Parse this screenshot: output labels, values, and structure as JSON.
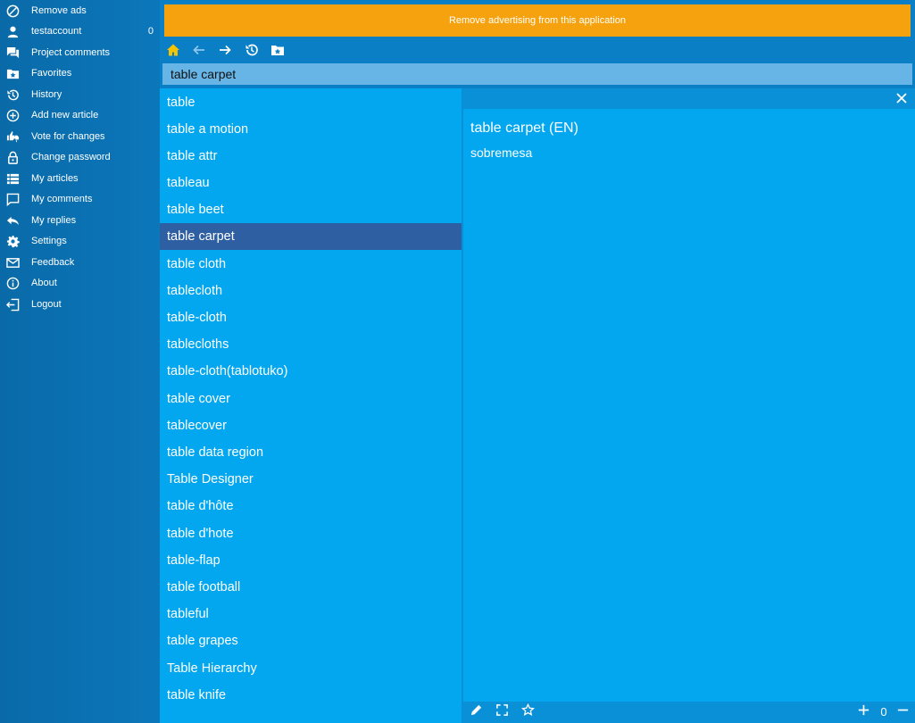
{
  "sidebar": {
    "items": [
      {
        "label": "Remove ads",
        "icon": "block-icon"
      },
      {
        "label": "testaccount",
        "icon": "user-icon",
        "count": "0"
      },
      {
        "label": "Project comments",
        "icon": "comments-icon"
      },
      {
        "label": "Favorites",
        "icon": "folder-star-icon"
      },
      {
        "label": "History",
        "icon": "history-icon"
      },
      {
        "label": "Add new article",
        "icon": "add-circle-icon"
      },
      {
        "label": "Vote for changes",
        "icon": "thumbs-icon"
      },
      {
        "label": "Change password",
        "icon": "lock-icon"
      },
      {
        "label": "My articles",
        "icon": "list-icon"
      },
      {
        "label": "My comments",
        "icon": "comment-icon"
      },
      {
        "label": "My replies",
        "icon": "reply-icon"
      },
      {
        "label": "Settings",
        "icon": "gear-icon"
      },
      {
        "label": "Feedback",
        "icon": "mail-icon"
      },
      {
        "label": "About",
        "icon": "info-icon"
      },
      {
        "label": "Logout",
        "icon": "logout-icon"
      }
    ]
  },
  "ad_banner": {
    "text": "Remove advertising from this application"
  },
  "toolbar": {
    "home_color": "#f5c400",
    "icons": [
      "home-icon",
      "back-icon",
      "forward-icon",
      "history-icon",
      "folder-star-icon"
    ]
  },
  "search": {
    "value": "table carpet"
  },
  "word_list": {
    "selected_index": 5,
    "items": [
      "table",
      "table a motion",
      "table attr",
      "tableau",
      "table beet",
      "table carpet",
      "table cloth",
      "tablecloth",
      "table-cloth",
      "tablecloths",
      "table-cloth(tablotuko)",
      "table cover",
      "tablecover",
      "table data region",
      "Table Designer",
      "table d'hôte",
      "table d'hote",
      "table-flap",
      "table football",
      "tableful",
      "table grapes",
      "Table Hierarchy",
      "table knife"
    ]
  },
  "entry": {
    "title": "table carpet (EN)",
    "translation": "sobremesa"
  },
  "footer": {
    "zoom": "0",
    "icons": [
      "edit-icon",
      "fullscreen-icon",
      "star-icon",
      "zoom-in-icon",
      "zoom-out-icon"
    ]
  },
  "colors": {
    "sidebar": "#0b77bb",
    "ad": "#f5a20e",
    "list_bg": "#03a7ef",
    "selected": "#2f5fa3",
    "search_bg": "#66b5e6"
  }
}
